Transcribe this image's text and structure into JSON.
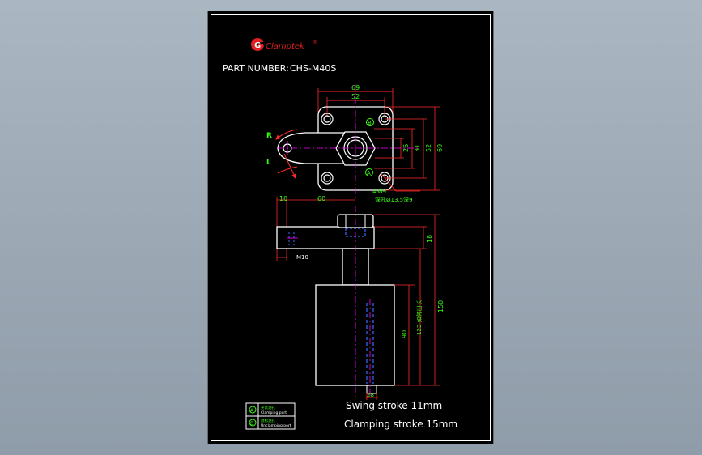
{
  "colors": {
    "background": "#000000",
    "outline": "#ffffff",
    "dimension": "#ff2a2a",
    "dimension_text": "#39ff14",
    "centerline": "#ff00ff",
    "hidden": "#3a6bff",
    "logo": "#e02020"
  },
  "brand": {
    "logo_letter": "G",
    "name": "Clamptek",
    "mark": "®"
  },
  "part": {
    "label": "PART NUMBER:",
    "number": "CHS-M40S"
  },
  "top_view": {
    "dims": {
      "width_outer": "69",
      "width_inner": "52",
      "h1": "26",
      "h2": "31",
      "h3": "52",
      "h4": "69"
    },
    "hole_note_line1": "4-Ø9",
    "hole_note_line2": "深孔Ø13.5深9",
    "arrow_right": "R",
    "arrow_left": "L",
    "port_a": "A",
    "port_b": "B"
  },
  "side_view": {
    "dims": {
      "arm_offset": "10",
      "arm_length": "60",
      "thread": "M10",
      "arm_height": "18",
      "stroke_total": "123",
      "overall": "150",
      "body": "90",
      "rod": "28"
    },
    "stroke_note": "123 如何出长"
  },
  "legend": [
    {
      "icon": "A",
      "title": "夹紧油孔",
      "subtitle": "Clamping port"
    },
    {
      "icon": "B",
      "title": "放松油孔",
      "subtitle": "Unclamping port"
    }
  ],
  "notes": {
    "swing_stroke": "Swing stroke 11mm",
    "clamping_stroke": "Clamping stroke 15mm"
  }
}
